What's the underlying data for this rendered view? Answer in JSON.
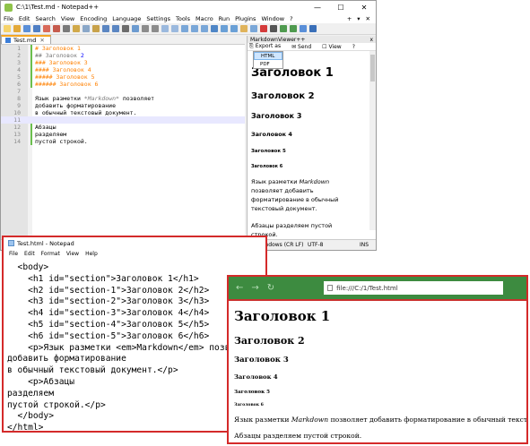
{
  "npp": {
    "title": "C:\\1\\Test.md - Notepad++",
    "window_buttons": [
      "—",
      "☐",
      "✕"
    ],
    "menu": [
      "File",
      "Edit",
      "Search",
      "View",
      "Encoding",
      "Language",
      "Settings",
      "Tools",
      "Macro",
      "Run",
      "Plugins",
      "Window",
      "?"
    ],
    "menu_right": [
      "+",
      "▾",
      "✕"
    ],
    "tab_label": "Test.md",
    "lines": [
      {
        "n": "1",
        "parts": [
          {
            "c": "h-orange",
            "t": "# Заголовок 1"
          }
        ]
      },
      {
        "n": "2",
        "parts": [
          {
            "c": "h-gray",
            "t": "## Заголовок "
          },
          {
            "c": "h-blue",
            "t": "2"
          }
        ]
      },
      {
        "n": "3",
        "parts": [
          {
            "c": "h-orange",
            "t": "### Заголовок 3"
          }
        ]
      },
      {
        "n": "4",
        "parts": [
          {
            "c": "h-orange",
            "t": "#### Заголовок 4"
          }
        ]
      },
      {
        "n": "5",
        "parts": [
          {
            "c": "h-orange",
            "t": "##### Заголовок 5"
          }
        ]
      },
      {
        "n": "6",
        "parts": [
          {
            "c": "h-orange",
            "t": "###### Заголовок 6"
          }
        ]
      },
      {
        "n": "7",
        "parts": []
      },
      {
        "n": "8",
        "parts": [
          {
            "c": "t-dark",
            "t": "Язык разметки "
          },
          {
            "c": "em-text",
            "t": "*Markdown*"
          },
          {
            "c": "t-dark",
            "t": " позволяет"
          }
        ]
      },
      {
        "n": "9",
        "parts": [
          {
            "c": "t-dark",
            "t": "добавить форматирование"
          }
        ]
      },
      {
        "n": "10",
        "parts": [
          {
            "c": "t-dark",
            "t": "в обычный текстовый документ."
          }
        ]
      },
      {
        "n": "11",
        "parts": []
      },
      {
        "n": "12",
        "parts": [
          {
            "c": "t-dark",
            "t": "Абзацы"
          }
        ]
      },
      {
        "n": "13",
        "parts": [
          {
            "c": "t-dark",
            "t": "разделяем"
          }
        ]
      },
      {
        "n": "14",
        "parts": [
          {
            "c": "t-dark",
            "t": "пустой строкой."
          }
        ]
      }
    ],
    "status": {
      "eol": "Windows (CR LF)",
      "encoding": "UTF-8",
      "mode": "INS"
    }
  },
  "mdviewer": {
    "title": "MarkdownViewer++",
    "close": "x",
    "export_label": "Export as",
    "send_label": "Send",
    "view_label": "View",
    "help_label": "?",
    "export_options": [
      "HTML",
      "PDF"
    ],
    "h1": "Заголовок 1",
    "h2": "Заголовок 2",
    "h3": "Заголовок 3",
    "h4": "Заголовок 4",
    "h5": "Заголовок 5",
    "h6": "Заголовок 6",
    "p1_before": "Язык разметки ",
    "p1_em": "Markdown",
    "p1_after": " позволяет добавить форматирование в обычный текстовый документ.",
    "p2": "Абзацы разделяем пустой строкой."
  },
  "notepad": {
    "title": "Test.html - Notepad",
    "menu": [
      "File",
      "Edit",
      "Format",
      "View",
      "Help"
    ],
    "text": "  <body>\n    <h1 id=\"section\">Заголовок 1</h1>\n    <h2 id=\"section-1\">Заголовок 2</h2>\n    <h3 id=\"section-2\">Заголовок 3</h3>\n    <h4 id=\"section-3\">Заголовок 4</h4>\n    <h5 id=\"section-4\">Заголовок 5</h5>\n    <h6 id=\"section-5\">Заголовок 6</h6>\n    <p>Язык разметки <em>Markdown</em> позволяет\nдобавить форматирование\nв обычный текстовый документ.</p>\n    <p>Абзацы\nразделяем\nпустой строкой.</p>\n  </body>\n</html>"
  },
  "browser": {
    "back": "←",
    "forward": "→",
    "reload": "↻",
    "url": "file:///C:/1/Test.html",
    "h1": "Заголовок 1",
    "h2": "Заголовок 2",
    "h3": "Заголовок 3",
    "h4": "Заголовок 4",
    "h5": "Заголовок 5",
    "h6": "Заголовок 6",
    "p1_before": "Язык разметки ",
    "p1_em": "Markdown",
    "p1_after": " позволяет добавить форматирование в обычный текстовый документ.",
    "p2": "Абзацы разделяем пустой строкой."
  },
  "colors": {
    "heading_orange": "#ff8000",
    "line_number_gray": "#8a8a8a",
    "browser_bar_green": "#3d8b40",
    "highlight_frame_red": "#d42a2a"
  }
}
